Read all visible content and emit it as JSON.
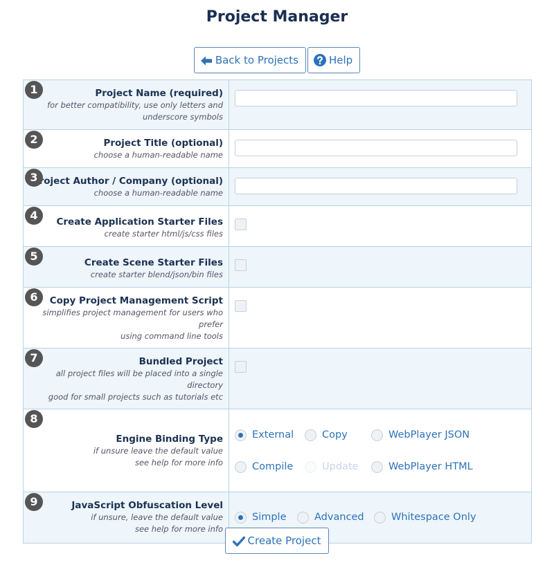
{
  "page": {
    "title": "Project Manager"
  },
  "toolbar": {
    "back_label": "Back to Projects",
    "help_label": "Help"
  },
  "rows": [
    {
      "num": "1",
      "label": "Project Name (required)",
      "hint1": "for better compatibility, use only letters and",
      "hint2": "underscore symbols"
    },
    {
      "num": "2",
      "label": "Project Title (optional)",
      "hint1": "choose a human-readable name"
    },
    {
      "num": "3",
      "label": "Project Author / Company (optional)",
      "hint1": "choose a human-readable name"
    },
    {
      "num": "4",
      "label": "Create Application Starter Files",
      "hint1": "create starter html/js/css files",
      "checked": false
    },
    {
      "num": "5",
      "label": "Create Scene Starter Files",
      "hint1": "create starter blend/json/bin files",
      "checked": false
    },
    {
      "num": "6",
      "label": "Copy Project Management Script",
      "hint1": "simplifies project management for users who prefer",
      "hint2": "using command line tools",
      "checked": false
    },
    {
      "num": "7",
      "label": "Bundled Project",
      "hint1": "all project files will be placed into a single directory",
      "hint2": "good for small projects such as tutorials etc",
      "checked": false
    },
    {
      "num": "8",
      "label": "Engine Binding Type",
      "hint1": "if unsure leave the default value",
      "hint2": "see help for more info",
      "options": [
        "External",
        "Copy",
        "WebPlayer JSON",
        "Compile",
        "Update",
        "WebPlayer HTML"
      ],
      "selected": "External",
      "disabled": [
        "Update"
      ]
    },
    {
      "num": "9",
      "label": "JavaScript Obfuscation Level",
      "hint1": "if unsure, leave the default value",
      "hint2": "see help for more info",
      "options": [
        "Simple",
        "Advanced",
        "Whitespace Only"
      ],
      "selected": "Simple"
    }
  ],
  "footer": {
    "create_label": "Create Project"
  },
  "colors": {
    "accent": "#2d72b8",
    "title": "#1a2e52",
    "badge": "#555555",
    "row_alt": "#eef5fb",
    "border": "#b8d4e0"
  },
  "icons": {
    "back": "arrow-left-icon",
    "help": "question-circle-icon",
    "create": "check-icon"
  }
}
